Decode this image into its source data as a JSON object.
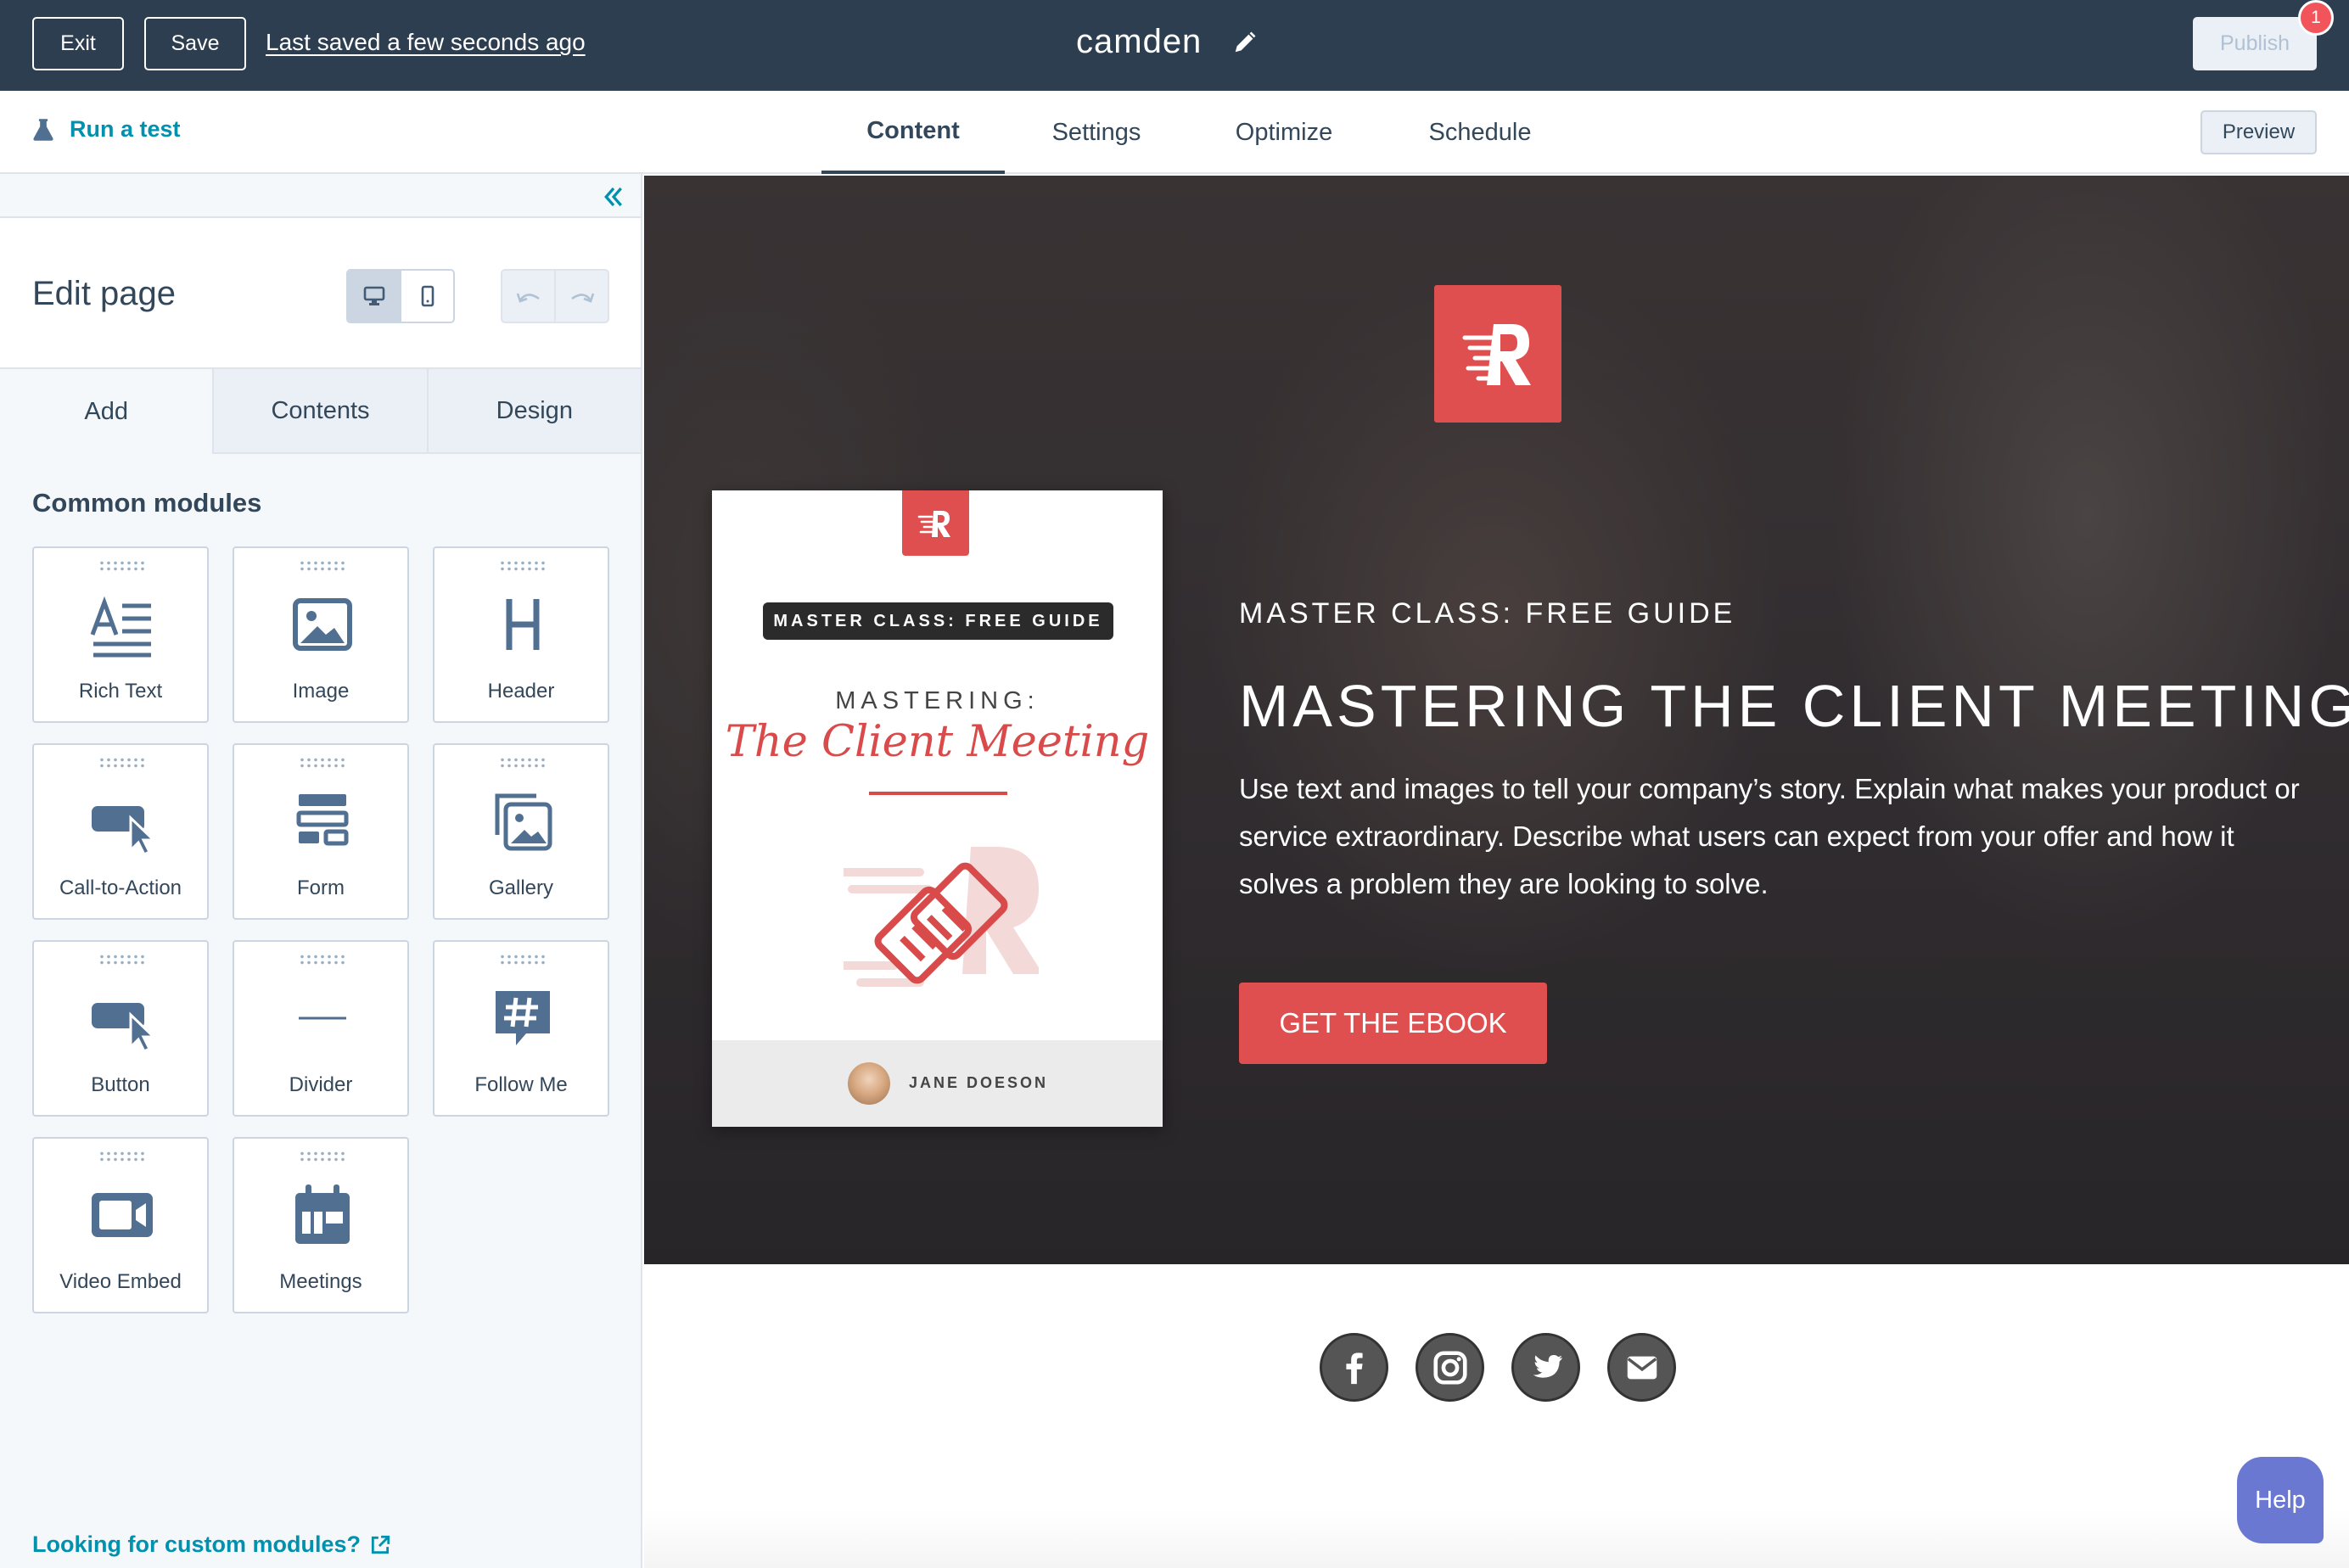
{
  "topbar": {
    "exit_label": "Exit",
    "save_label": "Save",
    "saved_status": "Last saved a few seconds ago",
    "page_name": "camden",
    "publish_label": "Publish",
    "notification_count": "1"
  },
  "navbar": {
    "run_test_label": "Run a test",
    "tabs": [
      {
        "label": "Content",
        "active": true
      },
      {
        "label": "Settings",
        "active": false
      },
      {
        "label": "Optimize",
        "active": false
      },
      {
        "label": "Schedule",
        "active": false
      }
    ],
    "preview_label": "Preview"
  },
  "sidebar": {
    "title": "Edit page",
    "tabs": [
      {
        "label": "Add",
        "active": true
      },
      {
        "label": "Contents",
        "active": false
      },
      {
        "label": "Design",
        "active": false
      }
    ],
    "section_title": "Common modules",
    "modules": [
      {
        "label": "Rich Text",
        "icon": "rich-text-icon"
      },
      {
        "label": "Image",
        "icon": "image-icon"
      },
      {
        "label": "Header",
        "icon": "header-icon"
      },
      {
        "label": "Call-to-Action",
        "icon": "cta-icon"
      },
      {
        "label": "Form",
        "icon": "form-icon"
      },
      {
        "label": "Gallery",
        "icon": "gallery-icon"
      },
      {
        "label": "Button",
        "icon": "button-icon"
      },
      {
        "label": "Divider",
        "icon": "divider-icon"
      },
      {
        "label": "Follow Me",
        "icon": "hashtag-icon"
      },
      {
        "label": "Video Embed",
        "icon": "video-icon"
      },
      {
        "label": "Meetings",
        "icon": "calendar-icon"
      }
    ],
    "custom_link": "Looking for custom modules?"
  },
  "hero": {
    "book": {
      "pill": "MASTER CLASS: FREE GUIDE",
      "mastering": "MASTERING:",
      "client_meeting": "The Client Meeting",
      "author": "JANE DOESON"
    },
    "eyebrow": "MASTER CLASS: FREE GUIDE",
    "title": "MASTERING THE CLIENT MEETING",
    "body": "Use text and images to tell your company’s story. Explain what makes your product or service extraordinary. Describe what users can expect from your offer and how it solves a problem they are looking to solve.",
    "cta_label": "GET THE EBOOK"
  },
  "social": [
    "facebook-icon",
    "instagram-icon",
    "twitter-icon",
    "email-icon"
  ],
  "help_label": "Help",
  "colors": {
    "topbar": "#2d3e50",
    "accent_link": "#0091ae",
    "brand_red": "#e04f4f",
    "help": "#6a78d1",
    "badge": "#f2545b"
  }
}
